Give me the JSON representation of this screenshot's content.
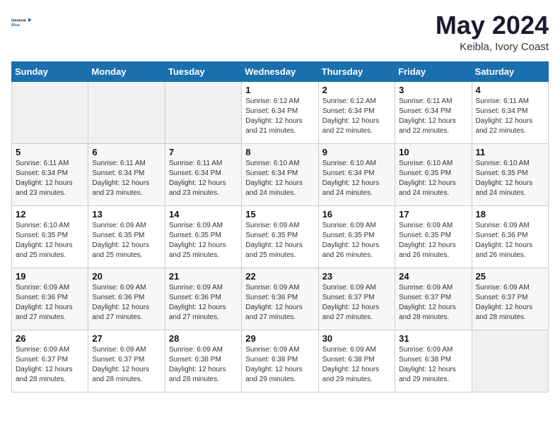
{
  "logo": {
    "line1": "General",
    "line2": "Blue"
  },
  "title": "May 2024",
  "subtitle": "Keibla, Ivory Coast",
  "days_header": [
    "Sunday",
    "Monday",
    "Tuesday",
    "Wednesday",
    "Thursday",
    "Friday",
    "Saturday"
  ],
  "weeks": [
    [
      {
        "day": "",
        "info": ""
      },
      {
        "day": "",
        "info": ""
      },
      {
        "day": "",
        "info": ""
      },
      {
        "day": "1",
        "info": "Sunrise: 6:12 AM\nSunset: 6:34 PM\nDaylight: 12 hours\nand 21 minutes."
      },
      {
        "day": "2",
        "info": "Sunrise: 6:12 AM\nSunset: 6:34 PM\nDaylight: 12 hours\nand 22 minutes."
      },
      {
        "day": "3",
        "info": "Sunrise: 6:11 AM\nSunset: 6:34 PM\nDaylight: 12 hours\nand 22 minutes."
      },
      {
        "day": "4",
        "info": "Sunrise: 6:11 AM\nSunset: 6:34 PM\nDaylight: 12 hours\nand 22 minutes."
      }
    ],
    [
      {
        "day": "5",
        "info": "Sunrise: 6:11 AM\nSunset: 6:34 PM\nDaylight: 12 hours\nand 23 minutes."
      },
      {
        "day": "6",
        "info": "Sunrise: 6:11 AM\nSunset: 6:34 PM\nDaylight: 12 hours\nand 23 minutes."
      },
      {
        "day": "7",
        "info": "Sunrise: 6:11 AM\nSunset: 6:34 PM\nDaylight: 12 hours\nand 23 minutes."
      },
      {
        "day": "8",
        "info": "Sunrise: 6:10 AM\nSunset: 6:34 PM\nDaylight: 12 hours\nand 24 minutes."
      },
      {
        "day": "9",
        "info": "Sunrise: 6:10 AM\nSunset: 6:34 PM\nDaylight: 12 hours\nand 24 minutes."
      },
      {
        "day": "10",
        "info": "Sunrise: 6:10 AM\nSunset: 6:35 PM\nDaylight: 12 hours\nand 24 minutes."
      },
      {
        "day": "11",
        "info": "Sunrise: 6:10 AM\nSunset: 6:35 PM\nDaylight: 12 hours\nand 24 minutes."
      }
    ],
    [
      {
        "day": "12",
        "info": "Sunrise: 6:10 AM\nSunset: 6:35 PM\nDaylight: 12 hours\nand 25 minutes."
      },
      {
        "day": "13",
        "info": "Sunrise: 6:09 AM\nSunset: 6:35 PM\nDaylight: 12 hours\nand 25 minutes."
      },
      {
        "day": "14",
        "info": "Sunrise: 6:09 AM\nSunset: 6:35 PM\nDaylight: 12 hours\nand 25 minutes."
      },
      {
        "day": "15",
        "info": "Sunrise: 6:09 AM\nSunset: 6:35 PM\nDaylight: 12 hours\nand 25 minutes."
      },
      {
        "day": "16",
        "info": "Sunrise: 6:09 AM\nSunset: 6:35 PM\nDaylight: 12 hours\nand 26 minutes."
      },
      {
        "day": "17",
        "info": "Sunrise: 6:09 AM\nSunset: 6:35 PM\nDaylight: 12 hours\nand 26 minutes."
      },
      {
        "day": "18",
        "info": "Sunrise: 6:09 AM\nSunset: 6:36 PM\nDaylight: 12 hours\nand 26 minutes."
      }
    ],
    [
      {
        "day": "19",
        "info": "Sunrise: 6:09 AM\nSunset: 6:36 PM\nDaylight: 12 hours\nand 27 minutes."
      },
      {
        "day": "20",
        "info": "Sunrise: 6:09 AM\nSunset: 6:36 PM\nDaylight: 12 hours\nand 27 minutes."
      },
      {
        "day": "21",
        "info": "Sunrise: 6:09 AM\nSunset: 6:36 PM\nDaylight: 12 hours\nand 27 minutes."
      },
      {
        "day": "22",
        "info": "Sunrise: 6:09 AM\nSunset: 6:36 PM\nDaylight: 12 hours\nand 27 minutes."
      },
      {
        "day": "23",
        "info": "Sunrise: 6:09 AM\nSunset: 6:37 PM\nDaylight: 12 hours\nand 27 minutes."
      },
      {
        "day": "24",
        "info": "Sunrise: 6:09 AM\nSunset: 6:37 PM\nDaylight: 12 hours\nand 28 minutes."
      },
      {
        "day": "25",
        "info": "Sunrise: 6:09 AM\nSunset: 6:37 PM\nDaylight: 12 hours\nand 28 minutes."
      }
    ],
    [
      {
        "day": "26",
        "info": "Sunrise: 6:09 AM\nSunset: 6:37 PM\nDaylight: 12 hours\nand 28 minutes."
      },
      {
        "day": "27",
        "info": "Sunrise: 6:09 AM\nSunset: 6:37 PM\nDaylight: 12 hours\nand 28 minutes."
      },
      {
        "day": "28",
        "info": "Sunrise: 6:09 AM\nSunset: 6:38 PM\nDaylight: 12 hours\nand 28 minutes."
      },
      {
        "day": "29",
        "info": "Sunrise: 6:09 AM\nSunset: 6:38 PM\nDaylight: 12 hours\nand 29 minutes."
      },
      {
        "day": "30",
        "info": "Sunrise: 6:09 AM\nSunset: 6:38 PM\nDaylight: 12 hours\nand 29 minutes."
      },
      {
        "day": "31",
        "info": "Sunrise: 6:09 AM\nSunset: 6:38 PM\nDaylight: 12 hours\nand 29 minutes."
      },
      {
        "day": "",
        "info": ""
      }
    ]
  ]
}
